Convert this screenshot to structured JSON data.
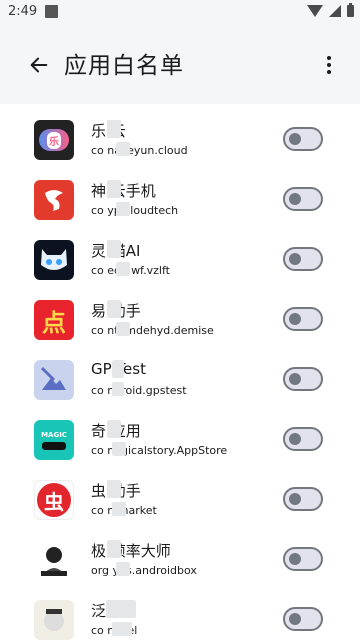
{
  "status": {
    "time": "2:49"
  },
  "app_bar": {
    "title": "应用白名单",
    "back_icon": "arrow-left-icon",
    "more_icon": "more-vert-icon"
  },
  "colors": {
    "switch_outline": "#73777f",
    "switch_track": "#e1e2ec",
    "bar_bg": "#f4f6f7"
  },
  "apps": [
    {
      "name": "乐 云",
      "pkg": "co naileyun.cloud",
      "enabled": false
    },
    {
      "name": "神 云手机",
      "pkg": "co yp.cloudtech",
      "enabled": false
    },
    {
      "name": "灵 喵AI",
      "pkg": "co eqplwf.vzlft",
      "enabled": false
    },
    {
      "name": "易 助手",
      "pkg": "co ntamdehyd.demise",
      "enabled": false
    },
    {
      "name": "GP Test",
      "pkg": "co ndroid.gpstest",
      "enabled": false
    },
    {
      "name": "奇 应用",
      "pkg": "co nagicalstory.AppStore",
      "enabled": false
    },
    {
      "name": "虫 助手",
      "pkg": "co n.market",
      "enabled": false
    },
    {
      "name": "极 帧率大师",
      "pkg": "org yds.androidbox",
      "enabled": false
    },
    {
      "name": "泛 说",
      "pkg": "co novel",
      "enabled": false
    }
  ]
}
